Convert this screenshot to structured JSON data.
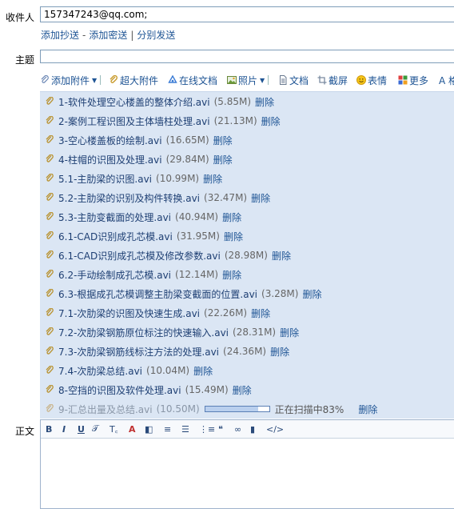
{
  "recipient": {
    "label": "收件人",
    "value": "157347243@qq.com;",
    "links": [
      "添加抄送",
      "添加密送",
      "分别发送"
    ],
    "link_separators": [
      "-",
      "|"
    ]
  },
  "subject": {
    "label": "主题",
    "value": ""
  },
  "toolbar": {
    "add_attachment": "添加附件",
    "big_attachment": "超大附件",
    "online_docs": "在线文档",
    "photos": "照片",
    "docs": "文档",
    "screenshot": "截屏",
    "emoji": "表情",
    "more": "更多",
    "format": "A 格"
  },
  "attachments": [
    {
      "name": "1-软件处理空心楼盖的整体介绍.avi",
      "size": "(5.85M)",
      "delete": "删除"
    },
    {
      "name": "2-案例工程识图及主体墙柱处理.avi",
      "size": "(21.13M)",
      "delete": "删除"
    },
    {
      "name": "3-空心楼盖板的绘制.avi",
      "size": "(16.65M)",
      "delete": "删除"
    },
    {
      "name": "4-柱帽的识图及处理.avi",
      "size": "(29.84M)",
      "delete": "删除"
    },
    {
      "name": "5.1-主肋梁的识图.avi",
      "size": "(10.99M)",
      "delete": "删除"
    },
    {
      "name": "5.2-主肋梁的识别及构件转换.avi",
      "size": "(32.47M)",
      "delete": "删除"
    },
    {
      "name": "5.3-主肋变截面的处理.avi",
      "size": "(40.94M)",
      "delete": "删除"
    },
    {
      "name": "6.1-CAD识别成孔芯模.avi",
      "size": "(31.95M)",
      "delete": "删除"
    },
    {
      "name": "6.1-CAD识别成孔芯模及修改参数.avi",
      "size": "(28.98M)",
      "delete": "删除"
    },
    {
      "name": "6.2-手动绘制成孔芯模.avi",
      "size": "(12.14M)",
      "delete": "删除"
    },
    {
      "name": "6.3-根据成孔芯模调整主肋梁变截面的位置.avi",
      "size": "(3.28M)",
      "delete": "删除"
    },
    {
      "name": "7.1-次肋梁的识图及快速生成.avi",
      "size": "(22.26M)",
      "delete": "删除"
    },
    {
      "name": "7.2-次肋梁钢筋原位标注的快速输入.avi",
      "size": "(28.31M)",
      "delete": "删除"
    },
    {
      "name": "7.3-次肋梁钢筋线标注方法的处理.avi",
      "size": "(24.36M)",
      "delete": "删除"
    },
    {
      "name": "7.4-次肋梁总结.avi",
      "size": "(10.04M)",
      "delete": "删除"
    },
    {
      "name": "8-空挡的识图及软件处理.avi",
      "size": "(15.49M)",
      "delete": "删除"
    }
  ],
  "pending_attachment": {
    "name": "9-汇总出量及总结.avi",
    "size": "(10.50M)",
    "status": "正在扫描中83%",
    "progress": 0.83,
    "delete": "删除"
  },
  "body": {
    "label": "正文",
    "editor_buttons": [
      "B",
      "I",
      "U",
      "𝒯",
      "T꜀",
      "A",
      "◧",
      "≡",
      "☰",
      "⋮≡",
      "❝",
      "∞",
      "▮",
      "</>"
    ]
  }
}
